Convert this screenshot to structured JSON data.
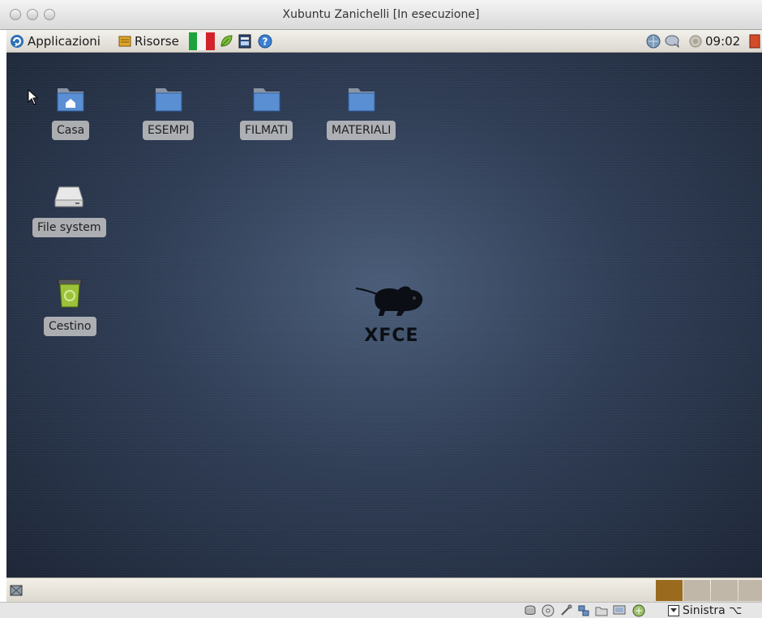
{
  "window": {
    "title": "Xubuntu Zanichelli [In esecuzione]"
  },
  "top_panel": {
    "menu_applicazioni": "Applicazioni",
    "menu_risorse": "Risorse",
    "clock": "09:02",
    "launchers": [
      "italy-flag-icon",
      "leaf-icon",
      "notes-icon",
      "help-icon"
    ],
    "tray": [
      "network-icon",
      "chat-icon",
      "volume-icon"
    ]
  },
  "desktop": {
    "icons": [
      {
        "name": "Casa",
        "icon": "home-folder-icon"
      },
      {
        "name": "ESEMPI",
        "icon": "folder-icon"
      },
      {
        "name": "FILMATI",
        "icon": "folder-icon"
      },
      {
        "name": "MATERIALI",
        "icon": "folder-icon"
      },
      {
        "name": "File system",
        "icon": "drive-icon"
      },
      {
        "name": "Cestino",
        "icon": "trash-icon"
      }
    ],
    "logo_text": "XFCE"
  },
  "bottom_panel": {
    "workspaces": 4,
    "active_workspace": 1
  },
  "status_bar": {
    "host_key": "Sinistra ⌥",
    "icons": [
      "hard-disk-icon",
      "cdrom-icon",
      "usb-icon",
      "network-status-icon",
      "shared-folder-icon",
      "display-icon",
      "capture-icon"
    ]
  },
  "colors": {
    "desktop_center": "#4a5c78",
    "desktop_edge": "#1d2637",
    "folder_blue": "#5b8fd4",
    "workspace_active": "#9a6a1e",
    "workspace_inactive": "#c0b7a8"
  }
}
